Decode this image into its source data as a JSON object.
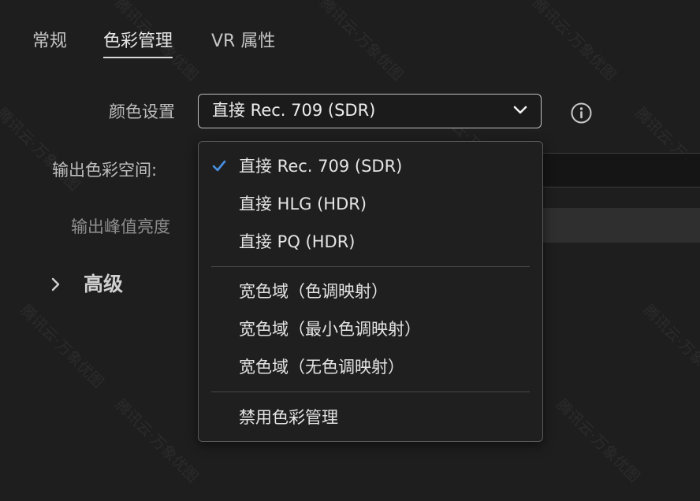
{
  "tabs": [
    {
      "label": "常规",
      "active": false
    },
    {
      "label": "色彩管理",
      "active": true
    },
    {
      "label": "VR 属性",
      "active": false
    }
  ],
  "settings": {
    "color_setting_label": "颜色设置",
    "output_colorspace_label": "输出色彩空间:",
    "output_peak_label": "输出峰值亮度",
    "advanced_label": "高级"
  },
  "select": {
    "value": "直接 Rec. 709 (SDR)"
  },
  "menu": {
    "group1": [
      {
        "label": "直接 Rec. 709 (SDR)",
        "checked": true
      },
      {
        "label": "直接 HLG (HDR)",
        "checked": false
      },
      {
        "label": "直接 PQ (HDR)",
        "checked": false
      }
    ],
    "group2": [
      {
        "label": "宽色域（色调映射）"
      },
      {
        "label": "宽色域（最小色调映射）"
      },
      {
        "label": "宽色域（无色调映射）"
      }
    ],
    "group3": [
      {
        "label": "禁用色彩管理"
      }
    ]
  },
  "watermark": {
    "text": "腾讯云·万象优图"
  },
  "colors": {
    "background": "#1e1e1e",
    "menu_background": "#1f1f1f",
    "check_accent": "#4a90e2",
    "text": "#e4e4e4"
  },
  "icons": {
    "info": "info-circle-icon",
    "chevron": "chevron-down-icon",
    "expand": "chevron-right-icon",
    "check": "checkmark-icon"
  }
}
